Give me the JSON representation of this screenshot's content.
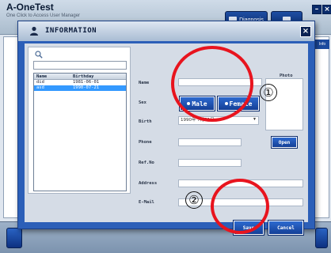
{
  "app": {
    "title": "A-OneTest",
    "subtitle": "One Click to Access User Manager",
    "buttons": [
      "Diagnosis",
      ""
    ],
    "right_tab": "Info"
  },
  "dialog": {
    "title": "INFORMATION",
    "close_glyph": "×",
    "list": {
      "search_placeholder": "",
      "columns": [
        "Name",
        "Birthday"
      ],
      "rows": [
        {
          "name": "did",
          "birthday": "1981-06-01",
          "selected": false
        },
        {
          "name": "asd",
          "birthday": "1990-07-21",
          "selected": true
        }
      ]
    },
    "form": {
      "name_label": "Name",
      "sex_label": "Sex",
      "male_label": "Male",
      "female_label": "Female",
      "birth_label": "Birth",
      "birth_value": "1990年 7月21日",
      "birth_arrow": "▼",
      "phone_label": "Phone",
      "refno_label": "Ref.No",
      "address_label": "Address",
      "email_label": "E-Mail",
      "photo_label": "Photo",
      "open_label": "Open",
      "save_label": "Save",
      "cancel_label": "Cancel"
    },
    "annotations": [
      {
        "number": "①",
        "color": "#e8141e"
      },
      {
        "number": "②",
        "color": "#e8141e"
      }
    ]
  }
}
